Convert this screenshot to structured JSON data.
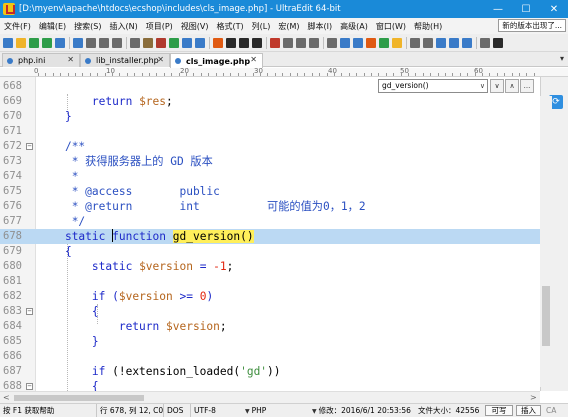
{
  "window": {
    "title": "[D:\\myenv\\apache\\htdocs\\ecshop\\includes\\cls_image.php] - UltraEdit 64-bit",
    "minimize": "—",
    "maximize": "☐",
    "close": "✕"
  },
  "menubar": {
    "items": [
      "文件(F)",
      "编辑(E)",
      "搜索(S)",
      "插入(N)",
      "项目(P)",
      "视图(V)",
      "格式(T)",
      "列(L)",
      "宏(M)",
      "脚本(I)",
      "高级(A)",
      "窗口(W)",
      "帮助(H)"
    ],
    "news_button": "新的版本出现了..."
  },
  "toolbar": {
    "icons": [
      "new-file-icon",
      "open-icon",
      "back-icon",
      "forward-icon",
      "save-icon",
      "save-all-icon",
      "print-icon",
      "cut-icon",
      "copy-icon",
      "paste-icon",
      "find-icon",
      "replace-icon",
      "word-wrap-icon",
      "ftp-icon",
      "compare-icon",
      "macro-icon",
      "settings-icon",
      "help-icon"
    ],
    "colors": [
      "#3a7bc8",
      "#f0b429",
      "#2e9d49",
      "#2e9d49",
      "#3a7bc8",
      "#3a7bc8",
      "#6b6b6b",
      "#6b6b6b",
      "#6b6b6b",
      "#6b6b6b",
      "#8a6d3b",
      "#b03a2e",
      "#2e9d49",
      "#3a7bc8",
      "#3a7bc8",
      "#e05a12",
      "#2a2a2a",
      "#2a2a2a",
      "#2a2a2a",
      "#c0392b",
      "#6b6b6b",
      "#6b6b6b",
      "#6b6b6b",
      "#6b6b6b",
      "#3a7bc8",
      "#3a7bc8",
      "#e05a12",
      "#2e9d49",
      "#f0b429",
      "#6b6b6b",
      "#6b6b6b",
      "#3a7bc8",
      "#3a7bc8",
      "#3a7bc8",
      "#6b6b6b",
      "#2a2a2a"
    ]
  },
  "tabs": [
    {
      "label": "php.ini",
      "close": "✕",
      "active": false
    },
    {
      "label": "lib_installer.php",
      "close": "✕",
      "active": false
    },
    {
      "label": "cls_image.php",
      "close": "✕",
      "active": true
    }
  ],
  "tab_menu": "▾",
  "ruler": [
    "0",
    "10",
    "20",
    "30",
    "40",
    "50",
    "60"
  ],
  "function_list": {
    "selected": "gd_version()",
    "dropdown_arrow": "∨",
    "down_button": "∨",
    "up_button": "∧",
    "more_button": "..."
  },
  "editor": {
    "lines": [
      {
        "num": "668",
        "fold": false,
        "highlight": false
      },
      {
        "num": "669",
        "fold": false,
        "highlight": false
      },
      {
        "num": "670",
        "fold": false,
        "highlight": false
      },
      {
        "num": "671",
        "fold": false,
        "highlight": false
      },
      {
        "num": "672",
        "fold": true,
        "highlight": false
      },
      {
        "num": "673",
        "fold": false,
        "highlight": false
      },
      {
        "num": "674",
        "fold": false,
        "highlight": false
      },
      {
        "num": "675",
        "fold": false,
        "highlight": false
      },
      {
        "num": "676",
        "fold": false,
        "highlight": false
      },
      {
        "num": "677",
        "fold": false,
        "highlight": false
      },
      {
        "num": "678",
        "fold": false,
        "highlight": true
      },
      {
        "num": "679",
        "fold": false,
        "highlight": false
      },
      {
        "num": "680",
        "fold": false,
        "highlight": false
      },
      {
        "num": "681",
        "fold": false,
        "highlight": false
      },
      {
        "num": "682",
        "fold": false,
        "highlight": false
      },
      {
        "num": "683",
        "fold": true,
        "highlight": false
      },
      {
        "num": "684",
        "fold": false,
        "highlight": false
      },
      {
        "num": "685",
        "fold": false,
        "highlight": false
      },
      {
        "num": "686",
        "fold": false,
        "highlight": false
      },
      {
        "num": "687",
        "fold": false,
        "highlight": false
      },
      {
        "num": "688",
        "fold": true,
        "highlight": false
      }
    ],
    "code": {
      "l669_kw": "return",
      "l669_var": "$res",
      "l669_end": ";",
      "l670": "}",
      "l672": "/**",
      "l673": "* 获得服务器上的 GD 版本",
      "l674": "*",
      "l675_tag": "* @access",
      "l675_val": "public",
      "l676_tag": "* @return",
      "l676_type": "int",
      "l676_desc": "可能的值为0，1，2",
      "l677": "*/",
      "l678_static": "static",
      "l678_function": "function",
      "l678_name": "gd_version()",
      "l679": "{",
      "l680_kw": "static",
      "l680_var": "$version",
      "l680_eq": " = ",
      "l680_num": "-1",
      "l680_end": ";",
      "l682_kw": "if",
      "l682_open": " (",
      "l682_var": "$version",
      "l682_op": " >= ",
      "l682_num": "0",
      "l682_close": ")",
      "l683": "{",
      "l684_kw": "return",
      "l684_var": "$version",
      "l684_end": ";",
      "l685": "}",
      "l687_kw": "if",
      "l687_open": " (!extension_loaded(",
      "l687_str": "'gd'",
      "l687_close": "))",
      "l688": "{"
    }
  },
  "statusbar": {
    "help": "按 F1 获取帮助",
    "position": "行 678, 列 12, C0",
    "line_ending": "DOS",
    "encoding": "UTF-8",
    "dropdown": "▼",
    "syntax": "PHP",
    "modified": "修改：2016/6/1 20:53:56",
    "file_size": "文件大小：42556",
    "mode_writable": "可写",
    "mode_insert": "插入",
    "caps": "CA"
  }
}
